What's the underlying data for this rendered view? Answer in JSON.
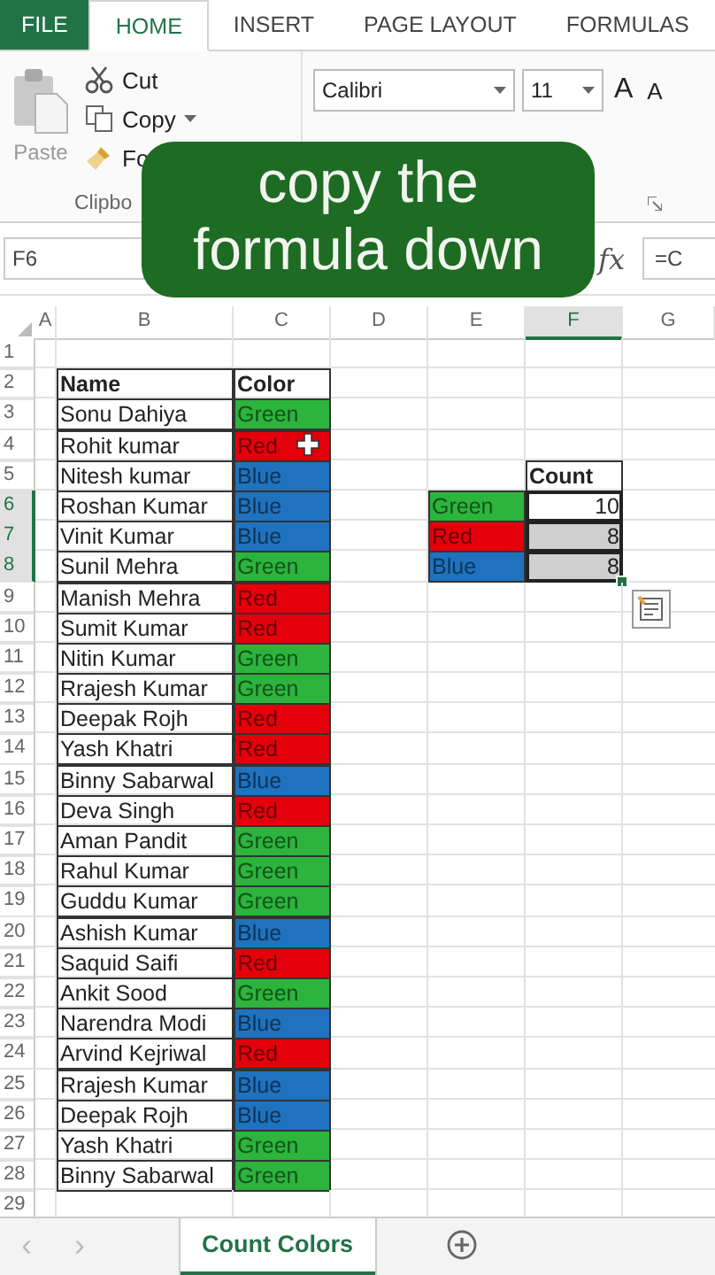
{
  "ribbon_tabs": [
    {
      "label": "FILE",
      "kind": "file",
      "selected": false
    },
    {
      "label": "HOME",
      "kind": "tab",
      "selected": true
    },
    {
      "label": "INSERT",
      "kind": "tab",
      "selected": false
    },
    {
      "label": "PAGE LAYOUT",
      "kind": "tab",
      "selected": false
    },
    {
      "label": "FORMULAS",
      "kind": "tab",
      "selected": false
    }
  ],
  "clipboard": {
    "paste": "Paste",
    "cut": "Cut",
    "copy": "Copy",
    "format_painter": "Fo",
    "group_label": "Clipbo"
  },
  "font": {
    "name": "Calibri",
    "size": "11",
    "grow": "A",
    "shrink": "A"
  },
  "caption": "copy the formula down",
  "name_box": "F6",
  "function_label": "fx",
  "formula": "=C",
  "columns": [
    {
      "label": "A",
      "selected": false
    },
    {
      "label": "B",
      "selected": false
    },
    {
      "label": "C",
      "selected": false
    },
    {
      "label": "D",
      "selected": false
    },
    {
      "label": "E",
      "selected": false
    },
    {
      "label": "F",
      "selected": true
    },
    {
      "label": "G",
      "selected": false
    }
  ],
  "row_headers": [
    {
      "label": "1",
      "selected": false
    },
    {
      "label": "2",
      "selected": false
    },
    {
      "label": "3",
      "selected": false
    },
    {
      "label": "4",
      "selected": false
    },
    {
      "label": "5",
      "selected": false
    },
    {
      "label": "6",
      "selected": true
    },
    {
      "label": "7",
      "selected": true
    },
    {
      "label": "8",
      "selected": true
    },
    {
      "label": "9",
      "selected": false
    },
    {
      "label": "10",
      "selected": false
    },
    {
      "label": "11",
      "selected": false
    },
    {
      "label": "12",
      "selected": false
    },
    {
      "label": "13",
      "selected": false
    },
    {
      "label": "14",
      "selected": false
    },
    {
      "label": "15",
      "selected": false
    },
    {
      "label": "16",
      "selected": false
    },
    {
      "label": "17",
      "selected": false
    },
    {
      "label": "18",
      "selected": false
    },
    {
      "label": "19",
      "selected": false
    },
    {
      "label": "20",
      "selected": false
    },
    {
      "label": "21",
      "selected": false
    },
    {
      "label": "22",
      "selected": false
    },
    {
      "label": "23",
      "selected": false
    },
    {
      "label": "24",
      "selected": false
    },
    {
      "label": "25",
      "selected": false
    },
    {
      "label": "26",
      "selected": false
    },
    {
      "label": "27",
      "selected": false
    },
    {
      "label": "28",
      "selected": false
    },
    {
      "label": "29",
      "selected": false
    }
  ],
  "table": {
    "header": [
      "Name",
      "Color"
    ],
    "rows": [
      {
        "name": "Sonu Dahiya",
        "color_label": "Green",
        "color": "#2cb43c"
      },
      {
        "name": "Rohit kumar",
        "color_label": "Red",
        "color": "#e3000b"
      },
      {
        "name": "Nitesh kumar",
        "color_label": "Blue",
        "color": "#1f72bd"
      },
      {
        "name": "Roshan Kumar",
        "color_label": "Blue",
        "color": "#1f72bd"
      },
      {
        "name": "Vinit Kumar",
        "color_label": "Blue",
        "color": "#1f72bd"
      },
      {
        "name": "Sunil Mehra",
        "color_label": "Green",
        "color": "#2cb43c"
      },
      {
        "name": "Manish Mehra",
        "color_label": "Red",
        "color": "#e3000b"
      },
      {
        "name": "Sumit Kumar",
        "color_label": "Red",
        "color": "#e3000b"
      },
      {
        "name": "Nitin Kumar",
        "color_label": "Green",
        "color": "#2cb43c"
      },
      {
        "name": "Rrajesh Kumar",
        "color_label": "Green",
        "color": "#2cb43c"
      },
      {
        "name": "Deepak Rojh",
        "color_label": "Red",
        "color": "#e3000b"
      },
      {
        "name": "Yash Khatri",
        "color_label": "Red",
        "color": "#e3000b"
      },
      {
        "name": "Binny Sabarwal",
        "color_label": "Blue",
        "color": "#1f72bd"
      },
      {
        "name": "Deva Singh",
        "color_label": "Red",
        "color": "#e3000b"
      },
      {
        "name": "Aman Pandit",
        "color_label": "Green",
        "color": "#2cb43c"
      },
      {
        "name": "Rahul Kumar",
        "color_label": "Green",
        "color": "#2cb43c"
      },
      {
        "name": "Guddu Kumar",
        "color_label": "Green",
        "color": "#2cb43c"
      },
      {
        "name": "Ashish Kumar",
        "color_label": "Blue",
        "color": "#1f72bd"
      },
      {
        "name": "Saquid Saifi",
        "color_label": "Red",
        "color": "#e3000b"
      },
      {
        "name": "Ankit Sood",
        "color_label": "Green",
        "color": "#2cb43c"
      },
      {
        "name": "Narendra Modi",
        "color_label": "Blue",
        "color": "#1f72bd"
      },
      {
        "name": "Arvind Kejriwal",
        "color_label": "Red",
        "color": "#e3000b"
      },
      {
        "name": "Rrajesh Kumar",
        "color_label": "Blue",
        "color": "#1f72bd"
      },
      {
        "name": "Deepak Rojh",
        "color_label": "Blue",
        "color": "#1f72bd"
      },
      {
        "name": "Yash Khatri",
        "color_label": "Green",
        "color": "#2cb43c"
      },
      {
        "name": "Binny Sabarwal",
        "color_label": "Green",
        "color": "#2cb43c"
      }
    ]
  },
  "count_table": {
    "header": "Count",
    "rows": [
      {
        "label": "Green",
        "color": "#2cb43c",
        "count": "10",
        "selected": true,
        "active": true
      },
      {
        "label": "Red",
        "color": "#e3000b",
        "count": "8",
        "selected": true,
        "active": false
      },
      {
        "label": "Blue",
        "color": "#1f72bd",
        "count": "8",
        "selected": true,
        "active": false
      }
    ]
  },
  "sheet_nav": [
    "‹",
    "›"
  ],
  "sheet_tabs": [
    {
      "label": "Count Colors",
      "selected": true
    }
  ]
}
